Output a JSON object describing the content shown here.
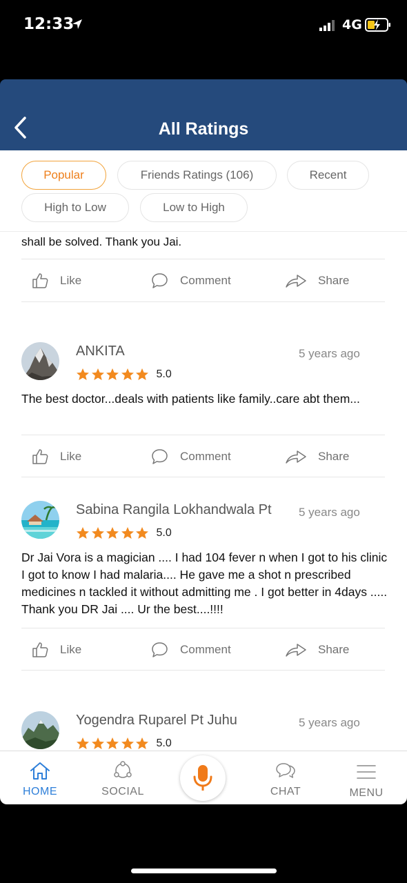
{
  "status_bar": {
    "time": "12:33",
    "network": "4G"
  },
  "header": {
    "title": "All Ratings"
  },
  "filters": [
    {
      "label": "Popular",
      "active": true
    },
    {
      "label": "Friends Ratings (106)",
      "active": false
    },
    {
      "label": "Recent",
      "active": false
    },
    {
      "label": "High to Low",
      "active": false
    },
    {
      "label": "Low to High",
      "active": false
    }
  ],
  "previous_review_tail": "shall be solved. Thank you Jai.",
  "actions": {
    "like": "Like",
    "comment": "Comment",
    "share": "Share"
  },
  "reviews": [
    {
      "name": "ANKITA",
      "time": "5 years ago",
      "score": "5.0",
      "rating": 5,
      "text": "The best doctor...deals with patients like family..care abt them..."
    },
    {
      "name": "Sabina Rangila Lokhandwala Pt",
      "time": "5 years ago",
      "score": "5.0",
      "rating": 5,
      "text": "Dr Jai Vora is a magician .... I had 104 fever n when I got to his clinic I got to know I had malaria.... He gave me a shot n prescribed medicines n tackled it without admitting me . I got better in 4days ..... Thank you DR Jai .... Ur the best....!!!!"
    },
    {
      "name": "Yogendra Ruparel Pt Juhu",
      "time": "5 years ago",
      "score": "5.0",
      "rating": 5
    }
  ],
  "bottom_nav": {
    "home": "HOME",
    "social": "SOCIAL",
    "chat": "CHAT",
    "menu": "MENU"
  },
  "colors": {
    "header": "#254a7c",
    "accent": "#ee7f1b",
    "star": "#f28a1f",
    "active_nav": "#2e7fd9"
  }
}
